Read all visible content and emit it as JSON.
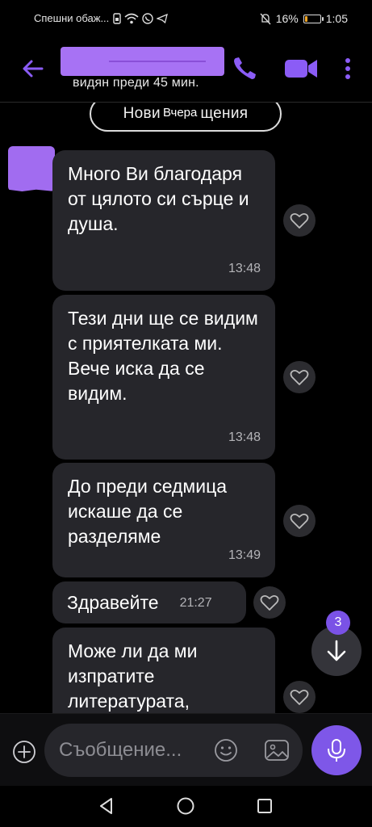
{
  "status_bar": {
    "left_text": "Спешни обаж...",
    "battery": "16%",
    "battery_level": 0.16,
    "time": "1:05"
  },
  "header": {
    "last_seen": "видян преди 45 мин.",
    "icons": [
      "back-arrow-icon",
      "phone-icon",
      "video-camera-icon",
      "more-vertical-icon"
    ]
  },
  "chat": {
    "new_messages_label": "Нови съобщения",
    "date_label": "Вчера",
    "messages": [
      {
        "text": "Много Ви благодаря от цялото си сърце и душа.",
        "time": "13:48"
      },
      {
        "text": "Тези дни ще се видим с приятелката ми. Вече иска да се видим.",
        "time": "13:48"
      },
      {
        "text": "До преди седмица искаше да се разделяме",
        "time": "13:49"
      },
      {
        "text": "Здравейте",
        "time": "21:27"
      },
      {
        "text": "Може ли да ми изпратите литературата,",
        "time": ""
      }
    ],
    "unread_count": "3"
  },
  "composer": {
    "placeholder": "Съобщение...",
    "value": ""
  },
  "colors": {
    "accent": "#7e57e8",
    "bubble": "#26262b",
    "background": "#000000"
  }
}
